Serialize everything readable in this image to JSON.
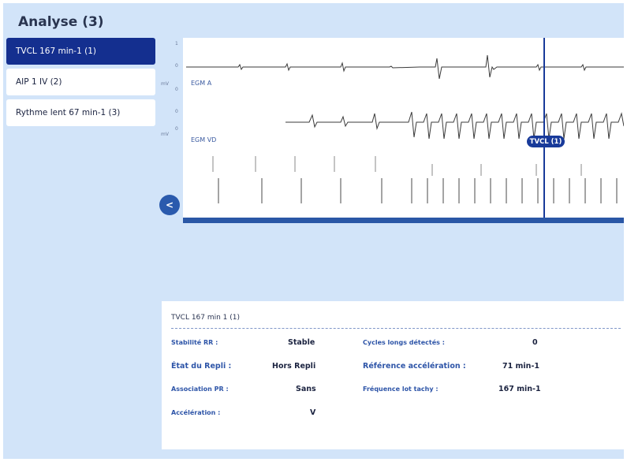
{
  "page": {
    "title": "Analyse (3)"
  },
  "episodes": [
    {
      "label": "TVCL 167 min-1 (1)",
      "active": true
    },
    {
      "label": "AIP 1 IV (2)",
      "active": false
    },
    {
      "label": "Rythme lent 67 min-1 (3)",
      "active": false
    }
  ],
  "tracing": {
    "unit": "mV",
    "scale_top": "1",
    "scale_zero": "0",
    "channel_a": "EGM A",
    "channel_vd": "EGM VD",
    "marker": "TVCL (1)",
    "collapse_glyph": "<"
  },
  "details": {
    "title": "TVCL 167 min 1 (1)",
    "fields": {
      "stabilite_label": "Stabilité RR :",
      "stabilite_value": "Stable",
      "cycles_label": "Cycles longs détectés :",
      "cycles_value": "0",
      "repli_label": "État du Repli :",
      "repli_value": "Hors Repli",
      "reference_label": "Référence accélération :",
      "reference_value": "71 min-1",
      "association_label": "Association PR :",
      "association_value": "Sans",
      "frequence_label": "Fréquence lot tachy :",
      "frequence_value": "167 min-1",
      "acceleration_label": "Accélération :",
      "acceleration_value": "V"
    }
  },
  "colors": {
    "panel_bg": "#d2e4f9",
    "active": "#142f8f",
    "accent": "#2a57a6",
    "label": "#2e55a8"
  }
}
